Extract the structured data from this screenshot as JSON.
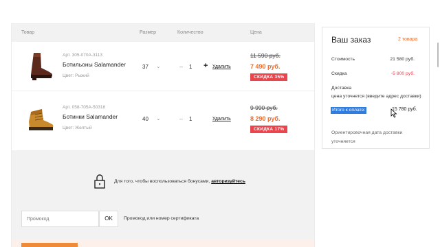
{
  "cart": {
    "columns": [
      "Товар",
      "Размер",
      "Количество",
      "Цена"
    ],
    "items": [
      {
        "article": "Арт. 305-070А-3113",
        "name": "Ботильоны Salamander",
        "color": "Цвет: Рыжий",
        "size": "37",
        "qty": "1",
        "remove_label": "Удалить",
        "old_price": "11 590 руб.",
        "new_price": "7 490 руб.",
        "discount": "СКИДКА 35%"
      },
      {
        "article": "Арт. 058-705А-50318",
        "name": "Ботинки Salamander",
        "color": "Цвет: Желтый",
        "size": "40",
        "qty": "1",
        "remove_label": "Удалить",
        "old_price": "9 990 руб.",
        "new_price": "8 290 руб.",
        "discount": "СКИДКА 17%"
      }
    ],
    "bonus": {
      "text": "Для того, чтобы воспользоваться бонусами,",
      "link": "авторизуйтесь"
    },
    "promo": {
      "placeholder": "Промокод",
      "button": "OK",
      "hint": "Промокод или номер сертификата"
    }
  },
  "summary": {
    "title": "Ваш заказ",
    "count": "2 товара",
    "cost_label": "Стоимость",
    "cost_value": "21 580 руб.",
    "discount_label": "Скидка",
    "discount_value": "-5 800 руб.",
    "delivery_label": "Доставка",
    "delivery_value": "цена уточнется (введите адрес доставки)",
    "total_label": "Итого к оплате:",
    "total_value": "15 780 руб.",
    "delivery_date": "Ориентировочная дата доставки уточняется"
  },
  "colors": {
    "accent": "#ee6b2a",
    "discount_badge": "#e8454c",
    "selection": "#2f7de1"
  }
}
